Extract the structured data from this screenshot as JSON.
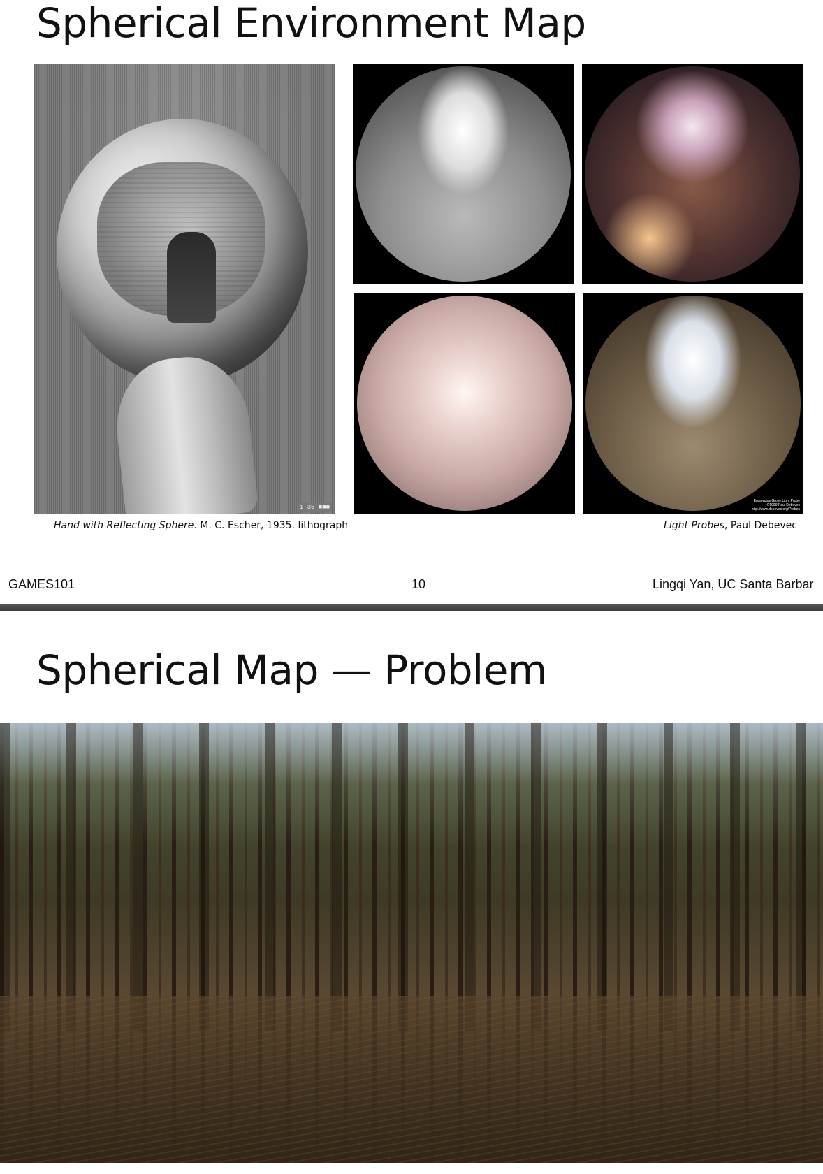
{
  "slide1": {
    "title": "Spherical Environment Map",
    "caption_left": {
      "italic": "Hand with Reflecting Sphere",
      "rest": ". M. C. Escher, 1935. lithograph"
    },
    "caption_right": {
      "italic": "Light Probes",
      "rest": ", Paul Debevec"
    },
    "escher_mark": "1-35 ■■■",
    "probe_credit": {
      "line1": "Eucalyptus Grove Light Probe",
      "line2": "©1999 Paul Debevec",
      "line3": "http://www.debevec.org/Probes"
    },
    "footer": {
      "left": "GAMES101",
      "center": "10",
      "right": "Lingqi Yan, UC Santa Barbar"
    }
  },
  "slide2": {
    "title": "Spherical Map — Problem"
  }
}
